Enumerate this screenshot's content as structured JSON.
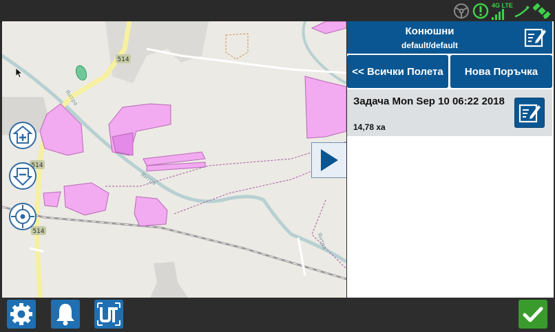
{
  "panel": {
    "title": "Конюшни",
    "subtitle": "default/default",
    "all_fields_label": "<< Всички Полета",
    "new_order_label": "Нова Поръчка"
  },
  "task": {
    "title": "Задача Mon Sep 10 06:22 2018",
    "area": "14,78 ха"
  },
  "status": {
    "network_label": "4G LTE"
  },
  "map": {
    "road_number": "514",
    "river_name": "Янтра"
  },
  "colors": {
    "accent": "#0a5692",
    "ok": "#3a9b2d",
    "field_fill": "#f2aaf0",
    "status_green": "#3ed14a"
  },
  "icons": [
    "steering-wheel-icon",
    "gps-warning-icon",
    "signal-icon",
    "satellite-icon",
    "edit-icon",
    "zoom-in-icon",
    "zoom-out-icon",
    "locate-icon",
    "play-icon",
    "settings-icon",
    "bell-icon",
    "ut-icon",
    "checkmark-icon"
  ]
}
